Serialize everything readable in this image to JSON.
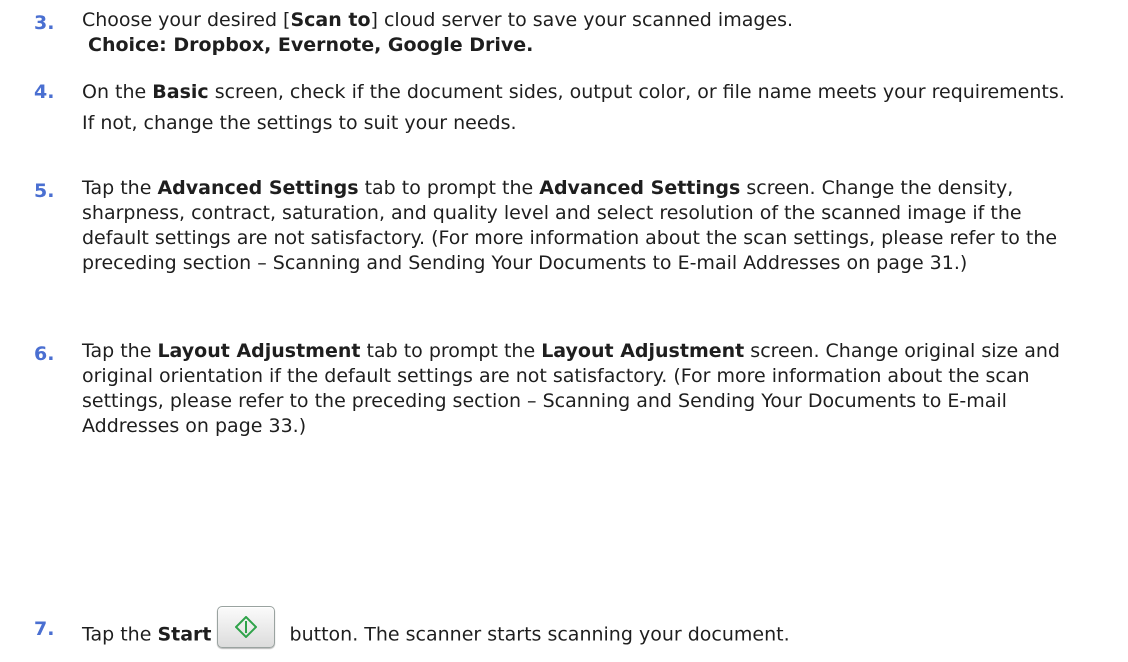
{
  "steps": [
    {
      "number": "3.",
      "text_a": "Choose your desired [",
      "bold_a": "Scan to",
      "text_b": "] cloud server to save your scanned images.",
      "extra_bold": "Choice: Dropbox, Evernote, Google Drive."
    },
    {
      "number": "4.",
      "text_a": "On the ",
      "bold_a": "Basic",
      "text_b": " screen, check if the document sides, output color, or file name meets your requirements.   If not, change the settings to suit your needs."
    },
    {
      "number": "5.",
      "text_a": "Tap the ",
      "bold_a": "Advanced Settings",
      "text_b": " tab to prompt the ",
      "bold_b": "Advanced Settings",
      "text_c": " screen. Change the density, sharpness, contract, saturation, and quality level and select resolution of the scanned image if the default settings are not satisfactory. (For more information about the scan settings, please refer to the preceding section – Scanning and Sending Your Documents to E-mail Addresses on page 31.)"
    },
    {
      "number": "6.",
      "text_a": "Tap the ",
      "bold_a": "Layout Adjustment",
      "text_b": " tab to prompt the ",
      "bold_b": "Layout Adjustment",
      "text_c": " screen. Change original size and original orientation if the default settings are not satisfactory. (For more information about the scan settings, please refer to the preceding section – Scanning and Sending Your Documents to E-mail Addresses on page 33.)"
    },
    {
      "number": "7.",
      "text_a": "Tap the ",
      "bold_a": "Start",
      "text_b": " button. The scanner starts scanning your document.",
      "button_icon": "start-diamond-icon"
    }
  ],
  "colors": {
    "step_number": "#4a6fd1",
    "start_icon": "#2fa34a"
  }
}
